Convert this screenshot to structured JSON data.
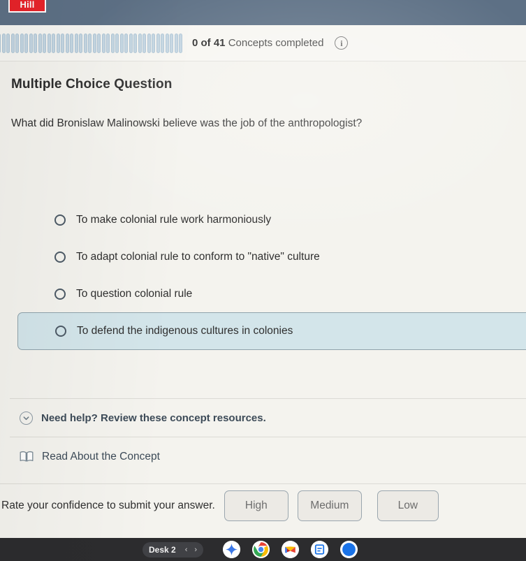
{
  "brand": {
    "logo_text": "Hill"
  },
  "progress": {
    "label_count": "0 of 41",
    "label_text": " Concepts completed",
    "completed": 0,
    "total": 41,
    "info_icon": "i",
    "bar_color": "#c4d6e2",
    "header_color": "#5d7085"
  },
  "question": {
    "type": "Multiple Choice Question",
    "prompt": "What did Bronislaw Malinowski believe was the job of the anthropologist?",
    "options": [
      {
        "label": "To make colonial rule work harmoniously",
        "selected": false
      },
      {
        "label": "To adapt colonial rule to conform to \"native\" culture",
        "selected": false
      },
      {
        "label": "To question colonial rule",
        "selected": false
      },
      {
        "label": "To defend the indigenous cultures in colonies",
        "selected": true
      }
    ],
    "highlight_color": "#d3e5ea"
  },
  "help": {
    "title": "Need help? Review these concept resources.",
    "resource_label": "Read About the Concept"
  },
  "confidence": {
    "prompt": "Rate your confidence to submit your answer.",
    "buttons": [
      "High",
      "Medium",
      "Low"
    ]
  },
  "shelf": {
    "desk_label": "Desk 2",
    "prev_arrow": "‹",
    "next_arrow": "›",
    "apps": [
      "gemini-icon",
      "chrome-icon",
      "gmail-icon",
      "docs-icon",
      "circle-app-icon"
    ]
  }
}
